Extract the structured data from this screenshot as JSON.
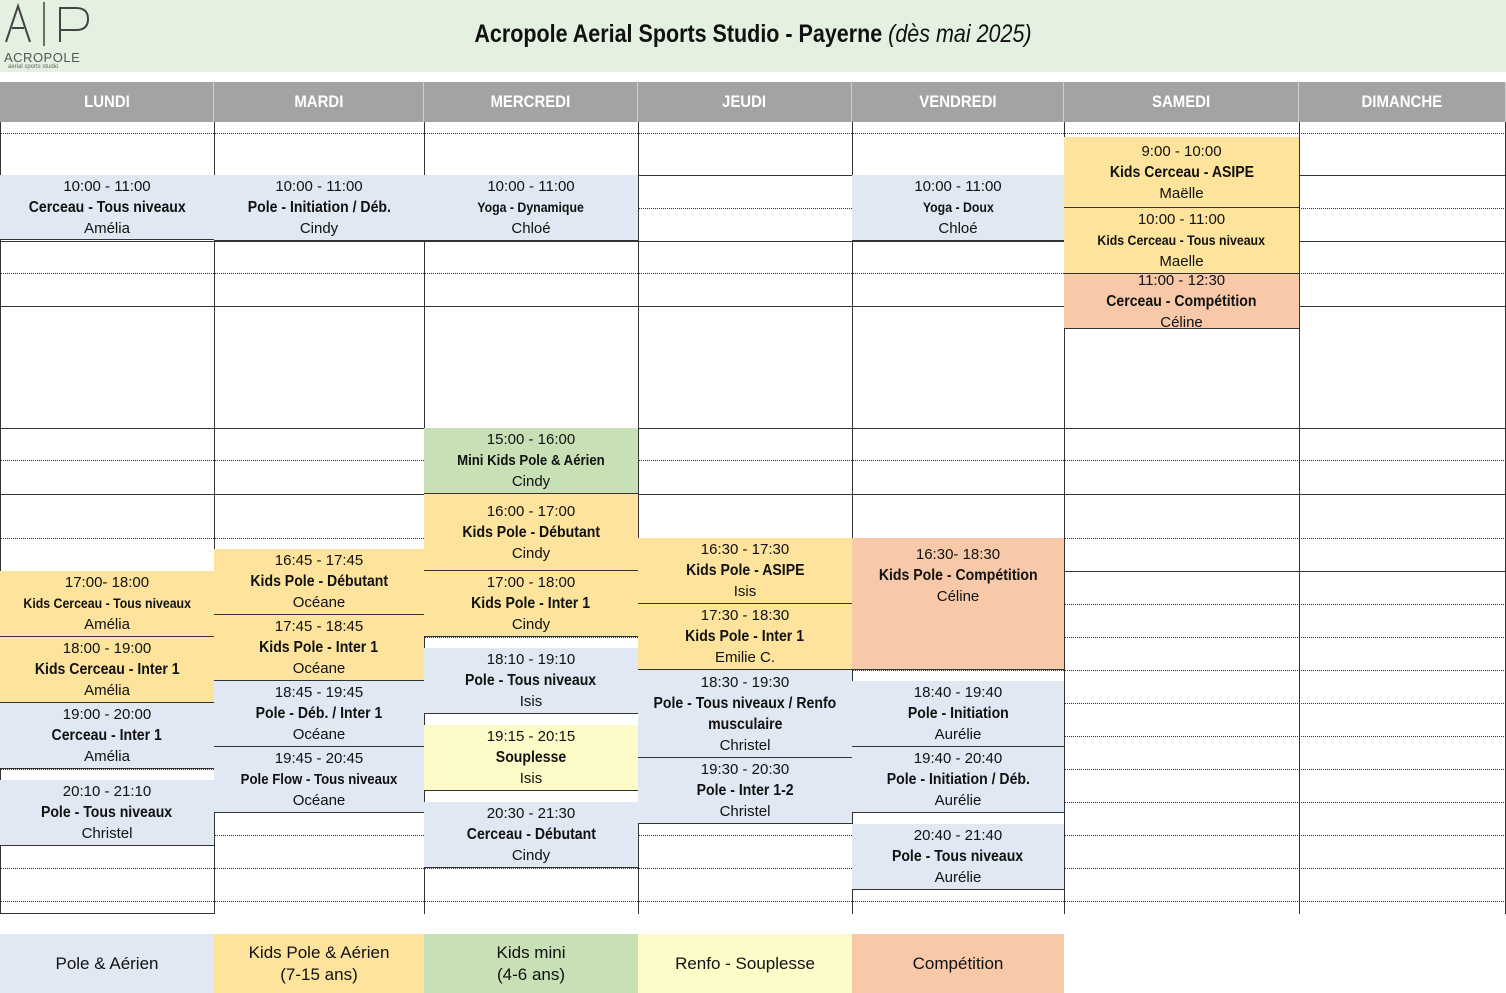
{
  "header": {
    "logo_letters": "A|P",
    "logo_word": "ACROPOLE",
    "logo_sub": "aerial sports studio",
    "title": "Acropole Aerial Sports Studio - Payerne",
    "subtitle": "(dès mai 2025)"
  },
  "colors": {
    "pole_aerien": "#dfe8f3",
    "kids_pole": "#fde39b",
    "kids_mini": "#c7e0b5",
    "renfo": "#fdfbc8",
    "competition": "#f7c9a8",
    "day_header": "#a3a3a3",
    "title_band": "#e4f1e0"
  },
  "days": [
    "LUNDI",
    "MARDI",
    "MERCREDI",
    "JEUDI",
    "VENDREDI",
    "SAMEDI",
    "DIMANCHE"
  ],
  "events": {
    "lundi_1": {
      "time": "10:00 - 11:00",
      "name": "Cerceau - Tous niveaux",
      "instructor": "Amélia",
      "category": "Pole & Aérien"
    },
    "lundi_2": {
      "time": "17:00- 18:00",
      "name": "Kids Cerceau - Tous niveaux",
      "instructor": "Amélia",
      "category": "Kids Pole & Aérien"
    },
    "lundi_3": {
      "time": "18:00 - 19:00",
      "name": "Kids Cerceau - Inter 1",
      "instructor": "Amélia",
      "category": "Kids Pole & Aérien"
    },
    "lundi_4": {
      "time": "19:00 - 20:00",
      "name": "Cerceau - Inter 1",
      "instructor": "Amélia",
      "category": "Pole & Aérien"
    },
    "lundi_5": {
      "time": "20:10 - 21:10",
      "name": "Pole - Tous niveaux",
      "instructor": "Christel",
      "category": "Pole & Aérien"
    },
    "mardi_1": {
      "time": "10:00 - 11:00",
      "name": "Pole - Initiation / Déb.",
      "instructor": "Cindy",
      "category": "Pole & Aérien"
    },
    "mardi_2": {
      "time": "16:45 - 17:45",
      "name": "Kids Pole - Débutant",
      "instructor": "Océane",
      "category": "Kids Pole & Aérien"
    },
    "mardi_3": {
      "time": "17:45 - 18:45",
      "name": "Kids Pole - Inter 1",
      "instructor": "Océane",
      "category": "Kids Pole & Aérien"
    },
    "mardi_4": {
      "time": "18:45 - 19:45",
      "name": "Pole - Déb. / Inter 1",
      "instructor": "Océane",
      "category": "Pole & Aérien"
    },
    "mardi_5": {
      "time": "19:45 - 20:45",
      "name": "Pole Flow - Tous niveaux",
      "instructor": "Océane",
      "category": "Pole & Aérien"
    },
    "mercredi_1": {
      "time": "10:00 - 11:00",
      "name": "Yoga - Dynamique",
      "instructor": "Chloé",
      "category": "Pole & Aérien"
    },
    "mercredi_2": {
      "time": "15:00 - 16:00",
      "name": "Mini Kids Pole & Aérien",
      "instructor": "Cindy",
      "category": "Kids mini"
    },
    "mercredi_3": {
      "time": "16:00 - 17:00",
      "name": "Kids Pole - Débutant",
      "instructor": "Cindy",
      "category": "Kids Pole & Aérien"
    },
    "mercredi_4": {
      "time": "17:00 - 18:00",
      "name": "Kids Pole - Inter 1",
      "instructor": "Cindy",
      "category": "Kids Pole & Aérien"
    },
    "mercredi_5": {
      "time": "18:10 - 19:10",
      "name": "Pole - Tous niveaux",
      "instructor": "Isis",
      "category": "Pole & Aérien"
    },
    "mercredi_6": {
      "time": "19:15 - 20:15",
      "name": "Souplesse",
      "instructor": "Isis",
      "category": "Renfo - Souplesse"
    },
    "mercredi_7": {
      "time": "20:30 - 21:30",
      "name": "Cerceau - Débutant",
      "instructor": "Cindy",
      "category": "Pole & Aérien"
    },
    "jeudi_1": {
      "time": "16:30 - 17:30",
      "name": "Kids Pole - ASIPE",
      "instructor": "Isis",
      "category": "Kids Pole & Aérien"
    },
    "jeudi_2": {
      "time": "17:30 - 18:30",
      "name": "Kids Pole - Inter 1",
      "instructor": "Emilie C.",
      "category": "Kids Pole & Aérien"
    },
    "jeudi_3": {
      "time": "18:30 - 19:30",
      "name_line1": "Pole - Tous niveaux / Renfo",
      "name_line2": "musculaire",
      "instructor": "Christel",
      "category": "Pole & Aérien"
    },
    "jeudi_4": {
      "time": "19:30 - 20:30",
      "name": "Pole - Inter 1-2",
      "instructor": "Christel",
      "category": "Pole & Aérien"
    },
    "vendredi_1": {
      "time": "10:00 - 11:00",
      "name": "Yoga - Doux",
      "instructor": "Chloé",
      "category": "Pole & Aérien"
    },
    "vendredi_2": {
      "time": "16:30- 18:30",
      "name": "Kids Pole - Compétition",
      "instructor": "Céline",
      "category": "Compétition"
    },
    "vendredi_3": {
      "time": "18:40 - 19:40",
      "name": "Pole - Initiation",
      "instructor": "Aurélie",
      "category": "Pole & Aérien"
    },
    "vendredi_4": {
      "time": "19:40 - 20:40",
      "name": "Pole - Initiation / Déb.",
      "instructor": "Aurélie",
      "category": "Pole & Aérien"
    },
    "vendredi_5": {
      "time": "20:40 - 21:40",
      "name": "Pole - Tous niveaux",
      "instructor": "Aurélie",
      "category": "Pole & Aérien"
    },
    "samedi_1": {
      "time": "9:00 - 10:00",
      "name": "Kids Cerceau - ASIPE",
      "instructor": "Maëlle",
      "category": "Kids Pole & Aérien"
    },
    "samedi_2": {
      "time": "10:00 - 11:00",
      "name": "Kids Cerceau - Tous niveaux",
      "instructor": "Maelle",
      "category": "Kids Pole & Aérien"
    },
    "samedi_3": {
      "time": "11:00 - 12:30",
      "name": "Cerceau - Compétition",
      "instructor": "Céline",
      "category": "Compétition"
    }
  },
  "legend": {
    "pole_aerien": "Pole & Aérien",
    "kids_pole_line1": "Kids Pole & Aérien",
    "kids_pole_line2": "(7-15 ans)",
    "kids_mini_line1": "Kids mini",
    "kids_mini_line2": "(4-6 ans)",
    "renfo": "Renfo - Souplesse",
    "competition": "Compétition"
  }
}
